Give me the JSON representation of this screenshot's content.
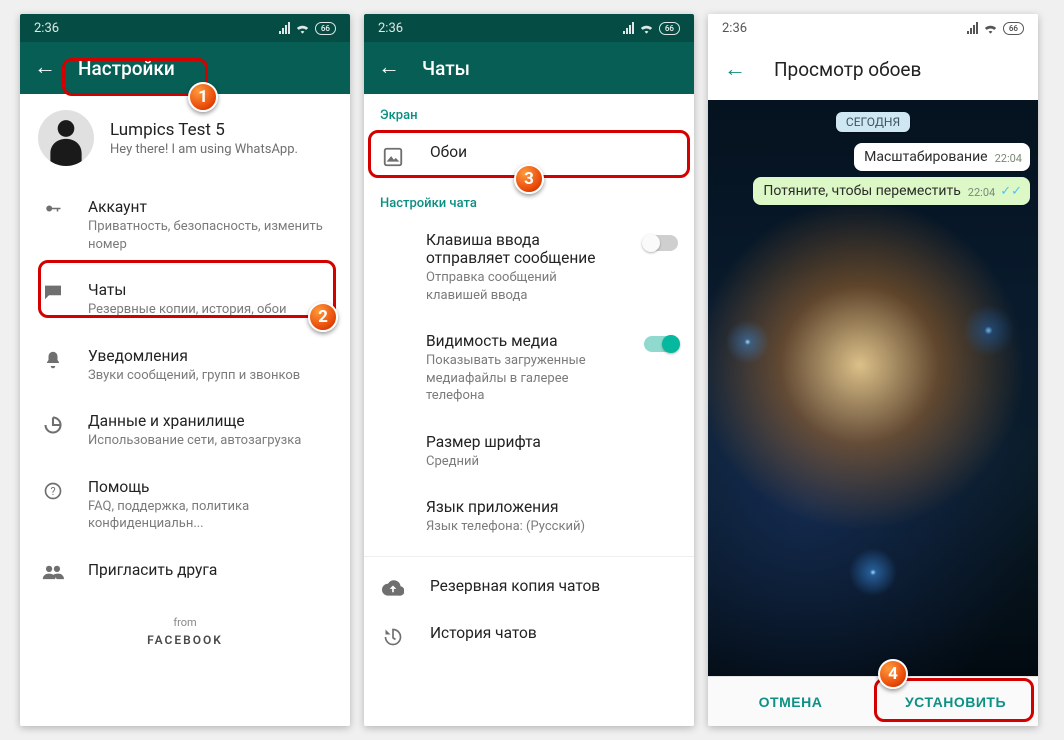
{
  "status": {
    "time": "2:36",
    "battery": "66"
  },
  "screen1": {
    "title": "Настройки",
    "profile": {
      "name": "Lumpics Test 5",
      "status": "Hey there! I am using WhatsApp."
    },
    "items": {
      "account": {
        "title": "Аккаунт",
        "sub": "Приватность, безопасность, изменить номер"
      },
      "chats": {
        "title": "Чаты",
        "sub": "Резервные копии, история, обои"
      },
      "notif": {
        "title": "Уведомления",
        "sub": "Звуки сообщений, групп и звонков"
      },
      "data": {
        "title": "Данные и хранилище",
        "sub": "Использование сети, автозагрузка"
      },
      "help": {
        "title": "Помощь",
        "sub": "FAQ, поддержка, политика конфиденциальн..."
      },
      "invite": {
        "title": "Пригласить друга"
      }
    },
    "from": "from",
    "facebook": "FACEBOOK"
  },
  "screen2": {
    "title": "Чаты",
    "section_screen": "Экран",
    "wallpaper": "Обои",
    "section_chat": "Настройки чата",
    "enter": {
      "title": "Клавиша ввода отправляет сообщение",
      "sub": "Отправка сообщений клавишей ввода"
    },
    "media": {
      "title": "Видимость медиа",
      "sub": "Показывать загруженные медиафайлы в галерее телефона"
    },
    "font": {
      "title": "Размер шрифта",
      "sub": "Средний"
    },
    "lang": {
      "title": "Язык приложения",
      "sub": "Язык телефона: (Русский)"
    },
    "backup": "Резервная копия чатов",
    "history": "История чатов"
  },
  "screen3": {
    "title": "Просмотр обоев",
    "date": "СЕГОДНЯ",
    "msg1": {
      "text": "Масштабирование",
      "time": "22:04"
    },
    "msg2": {
      "text": "Потяните, чтобы переместить",
      "time": "22:04"
    },
    "cancel": "ОТМЕНА",
    "set": "УСТАНОВИТЬ"
  },
  "badges": {
    "b1": "1",
    "b2": "2",
    "b3": "3",
    "b4": "4"
  }
}
